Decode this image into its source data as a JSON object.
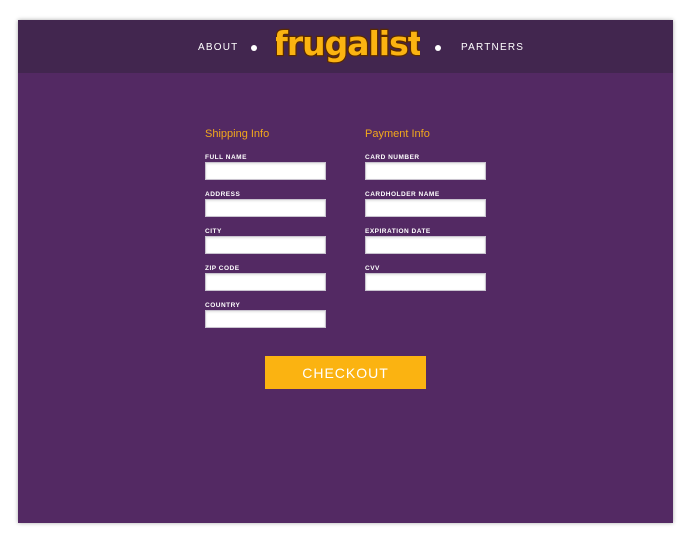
{
  "header": {
    "nav_left": "ABOUT",
    "logo_text": "frugalist",
    "nav_right": "PARTNERS"
  },
  "shipping": {
    "title": "Shipping Info",
    "fields": [
      {
        "label": "FULL NAME",
        "value": ""
      },
      {
        "label": "ADDRESS",
        "value": ""
      },
      {
        "label": "CITY",
        "value": ""
      },
      {
        "label": "ZIP CODE",
        "value": ""
      },
      {
        "label": "COUNTRY",
        "value": ""
      }
    ]
  },
  "payment": {
    "title": "Payment Info",
    "fields": [
      {
        "label": "CARD NUMBER",
        "value": ""
      },
      {
        "label": "CARDHOLDER NAME",
        "value": ""
      },
      {
        "label": "EXPIRATION DATE",
        "value": ""
      },
      {
        "label": "CVV",
        "value": ""
      }
    ]
  },
  "checkout_label": "CHECKOUT",
  "colors": {
    "background": "#532963",
    "header": "#42264f",
    "accent": "#fbb311",
    "section_title": "#f2a81c",
    "logo_outline": "#5a2a00"
  }
}
